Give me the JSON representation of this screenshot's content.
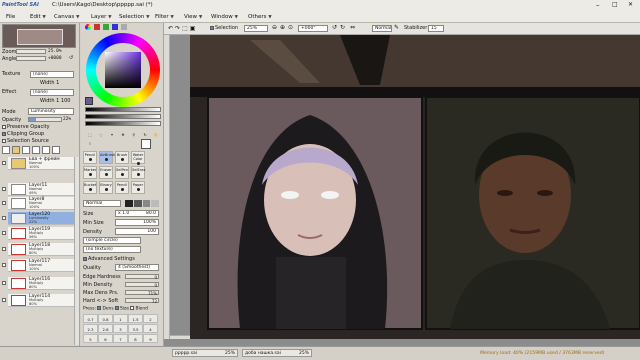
{
  "window": {
    "logo": "PaintTool SAI",
    "title": "C:\\Users\\Kago\\Desktop\\ppppp.sai (*)"
  },
  "menu": [
    "File",
    "Edit",
    "Canvas",
    "Layer",
    "Selection",
    "Filter",
    "View",
    "Window",
    "Others"
  ],
  "toolbar": {
    "selection_label": "Selection",
    "zoom": "25%",
    "angle": "+000°",
    "mode": "Normal",
    "stabilizer_label": "Stabilizer",
    "stabilizer": "15"
  },
  "navigator": {
    "zoom_label": "Zoom",
    "zoom_value": "25.0%",
    "angle_label": "Angle",
    "angle_value": "+0000"
  },
  "layer_props": {
    "texture_label": "Texture",
    "texture": "(none)",
    "effect_label": "Effect",
    "effect": "(none)",
    "width_label": "Width",
    "width": "1",
    "intensity": "100",
    "mode_label": "Mode",
    "mode": "Luminosity",
    "opacity_label": "Opacity",
    "opacity": "22%",
    "opacity_fraction": 0.22,
    "preserve": "Preserve Opacity",
    "clipping": "Clipping Group",
    "selection_source": "Selection Source"
  },
  "layers": [
    {
      "name": "Ева + фрейм",
      "mode": "Normal",
      "opacity": "100%",
      "folder": true
    },
    {
      "name": "Layer11",
      "mode": "Normal",
      "opacity": "49%"
    },
    {
      "name": "Layer8",
      "mode": "Normal",
      "opacity": "100%"
    },
    {
      "name": "Layer120",
      "mode": "Luminosity",
      "opacity": "22%",
      "selected": true
    },
    {
      "name": "Layer119",
      "mode": "Multiply",
      "opacity": "56%"
    },
    {
      "name": "Layer118",
      "mode": "Multiply",
      "opacity": "80%"
    },
    {
      "name": "Layer117",
      "mode": "Normal",
      "opacity": "100%"
    },
    {
      "name": "Layer116",
      "mode": "Multiply",
      "opacity": "80%"
    },
    {
      "name": "Layer114",
      "mode": "Multiply",
      "opacity": "80%"
    }
  ],
  "tools": [
    {
      "name": "Pencil"
    },
    {
      "name": "AirBrush",
      "sel": true
    },
    {
      "name": "Brush"
    },
    {
      "name": "Water Color"
    },
    {
      "name": "Marker"
    },
    {
      "name": "Eraser"
    },
    {
      "name": "SelPen"
    },
    {
      "name": "SelEras"
    },
    {
      "name": "Bucket"
    },
    {
      "name": "Binary"
    },
    {
      "name": "Pencil"
    },
    {
      "name": "Paper"
    }
  ],
  "brush": {
    "blend_mode": "Normal",
    "size_label": "Size",
    "size_mult": "x 1.0",
    "size": "80.0",
    "minsize_label": "Min Size",
    "minsize": "100%",
    "density_label": "Density",
    "density": "100",
    "shape": "(simple circle)",
    "texture": "(no texture)",
    "advanced": "Advanced Settings",
    "quality_label": "Quality",
    "quality": "4 (Smoothest)",
    "edge_label": "Edge Hardness",
    "edge": "0",
    "mindens_label": "Min Density",
    "mindens": "0",
    "maxdens_label": "Max Dens Prs.",
    "maxdens": "71%",
    "hardsoft_label": "Hard <-> Soft",
    "hardsoft": "72",
    "press_label": "Press:",
    "dens_label": "Dens",
    "size_chk": "Size",
    "blend": "Blend"
  },
  "brush_sizes": [
    "0.7",
    "0.8",
    "1",
    "1.5",
    "2",
    "2.3",
    "2.6",
    "3",
    "3.5",
    "4",
    "5",
    "6",
    "7",
    "8",
    "9"
  ],
  "tabs": [
    {
      "name": "ppppp.sai",
      "zoom": "25%"
    },
    {
      "name": "доба нашка.sai",
      "zoom": "25%"
    }
  ],
  "status": {
    "memory": "Memory load: 40% (2159MB used / 3763MB reserved)"
  },
  "colors": {
    "accent": "#7a9bc8",
    "selected_layer": "#8fb0e0",
    "current_color": "#6a5a8e"
  }
}
